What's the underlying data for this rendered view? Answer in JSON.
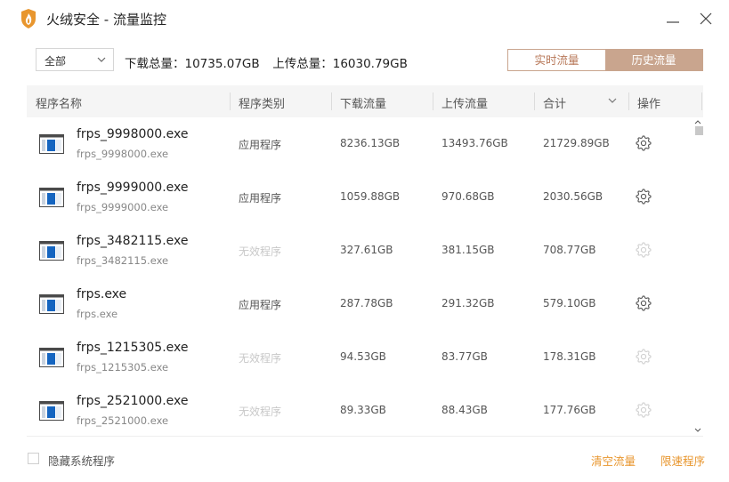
{
  "window": {
    "title": "火绒安全 - 流量监控",
    "accent": "#c9a58e",
    "link_color": "#e8962e"
  },
  "toolbar": {
    "filter_value": "全部",
    "download_total": "下载总量：10735.07GB",
    "upload_total": "上传总量：16030.79GB",
    "tab_realtime": "实时流量",
    "tab_history": "历史流量",
    "active_tab": "历史流量"
  },
  "table": {
    "headers": {
      "name": "程序名称",
      "type": "程序类别",
      "download": "下载流量",
      "upload": "上传流量",
      "total": "合计",
      "action": "操作"
    },
    "rows": [
      {
        "name": "frps_9998000.exe",
        "sub": "frps_9998000.exe",
        "type": "应用程序",
        "valid": true,
        "download": "8236.13GB",
        "upload": "13493.76GB",
        "total": "21729.89GB"
      },
      {
        "name": "frps_9999000.exe",
        "sub": "frps_9999000.exe",
        "type": "应用程序",
        "valid": true,
        "download": "1059.88GB",
        "upload": "970.68GB",
        "total": "2030.56GB"
      },
      {
        "name": "frps_3482115.exe",
        "sub": "frps_3482115.exe",
        "type": "无效程序",
        "valid": false,
        "download": "327.61GB",
        "upload": "381.15GB",
        "total": "708.77GB"
      },
      {
        "name": "frps.exe",
        "sub": "frps.exe",
        "type": "应用程序",
        "valid": true,
        "download": "287.78GB",
        "upload": "291.32GB",
        "total": "579.10GB"
      },
      {
        "name": "frps_1215305.exe",
        "sub": "frps_1215305.exe",
        "type": "无效程序",
        "valid": false,
        "download": "94.53GB",
        "upload": "83.77GB",
        "total": "178.31GB"
      },
      {
        "name": "frps_2521000.exe",
        "sub": "frps_2521000.exe",
        "type": "无效程序",
        "valid": false,
        "download": "89.33GB",
        "upload": "88.43GB",
        "total": "177.76GB"
      }
    ]
  },
  "footer": {
    "hide_system_label": "隐藏系统程序",
    "hide_system_checked": false,
    "clear_traffic": "清空流量",
    "limit_program": "限速程序"
  }
}
